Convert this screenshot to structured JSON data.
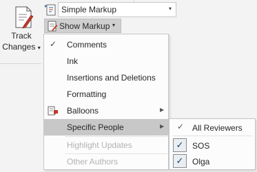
{
  "ribbon": {
    "track_changes": {
      "line1": "Track",
      "line2": "Changes",
      "dropdown_arrow": "▾",
      "icon": "track-changes-icon"
    },
    "markup_select": {
      "value": "Simple Markup",
      "arrow": "▾",
      "icon": "markup-display-icon"
    },
    "show_markup": {
      "label": "Show Markup",
      "arrow": "▾",
      "icon": "show-markup-icon"
    }
  },
  "menu": {
    "items": [
      {
        "label": "Comments",
        "checked": true,
        "check": "✓"
      },
      {
        "label": "Ink"
      },
      {
        "label": "Insertions and Deletions"
      },
      {
        "label": "Formatting"
      },
      {
        "label": "Balloons",
        "icon": "balloons-icon",
        "submenu_arrow": "▶"
      },
      {
        "label": "Specific People",
        "submenu_arrow": "▶",
        "hover": true
      },
      {
        "label": "Highlight Updates",
        "disabled": true
      },
      {
        "label": "Other Authors",
        "disabled": true
      }
    ]
  },
  "submenu": {
    "items": [
      {
        "label": "All Reviewers",
        "check": "✓"
      },
      {
        "label": "SOS",
        "checkbox": "✓"
      },
      {
        "label": "Olga",
        "checkbox": "✓"
      }
    ]
  },
  "colors": {
    "menu_background": "#fcfcfc",
    "hover_background": "#c8c8c8",
    "disabled_text": "#b2b2b2",
    "accent_red": "#c0392b"
  }
}
